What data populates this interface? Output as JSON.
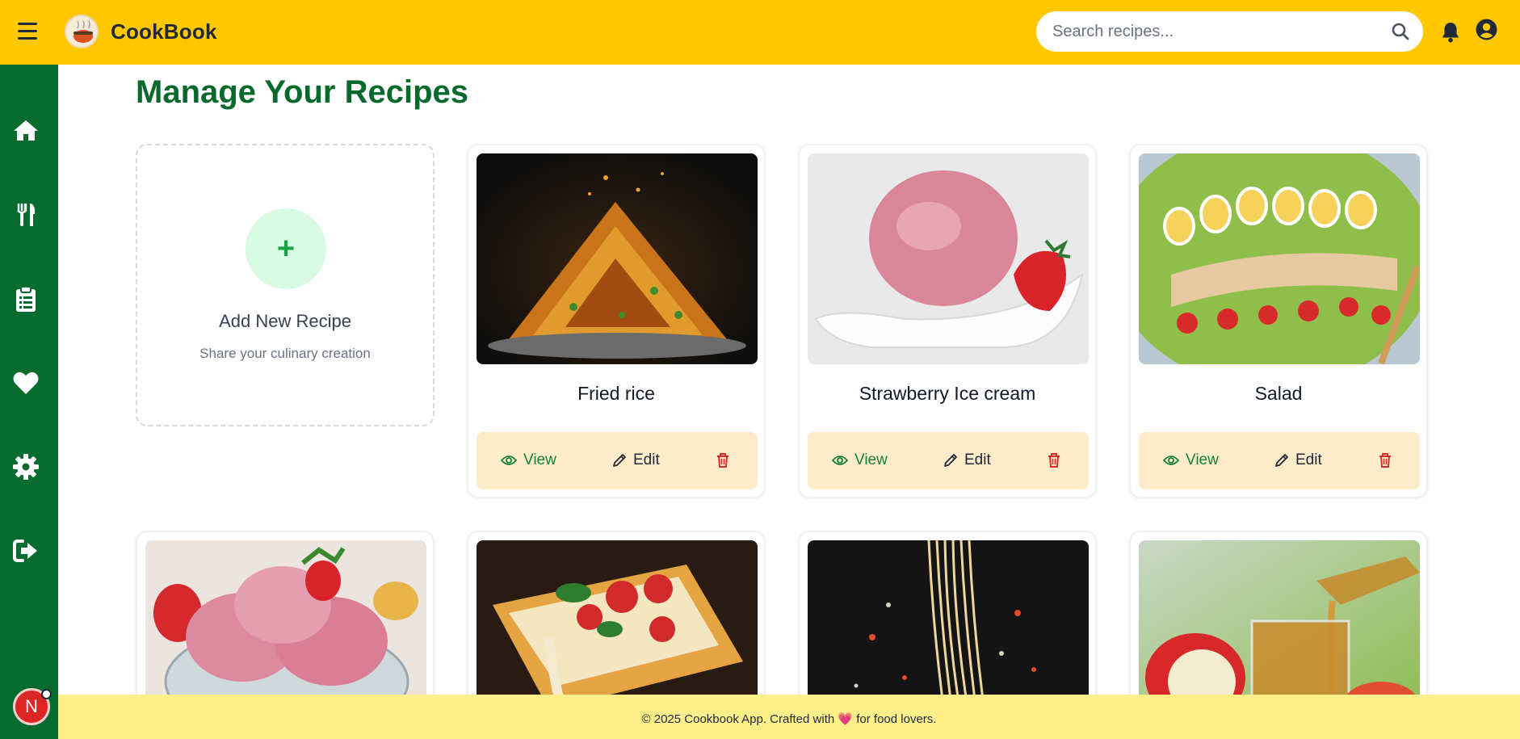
{
  "header": {
    "brand": "CookBook",
    "search_placeholder": "Search recipes..."
  },
  "page": {
    "title": "Manage Your Recipes"
  },
  "add_card": {
    "plus": "+",
    "title": "Add New Recipe",
    "subtitle": "Share your culinary creation"
  },
  "actions": {
    "view": "View",
    "edit": "Edit"
  },
  "recipes": [
    {
      "name": "Fried rice"
    },
    {
      "name": "Strawberry Ice cream"
    },
    {
      "name": "Salad"
    }
  ],
  "user": {
    "initial": "N"
  },
  "footer": {
    "before": "© 2025 Cookbook App. Crafted with",
    "heart": "💗",
    "after": "for food lovers."
  },
  "colors": {
    "topbar": "#ffc800",
    "sidebar": "#076b2f",
    "title": "#07692c",
    "actions_bg": "#fdebc9",
    "footer_bg": "#fdf08a"
  },
  "icons": [
    "menu-icon",
    "search-icon",
    "bell-icon",
    "user-circle-icon",
    "home-icon",
    "utensils-icon",
    "clipboard-list-icon",
    "heart-icon",
    "gear-icon",
    "sign-out-icon",
    "eye-icon",
    "pencil-icon",
    "trash-icon"
  ]
}
